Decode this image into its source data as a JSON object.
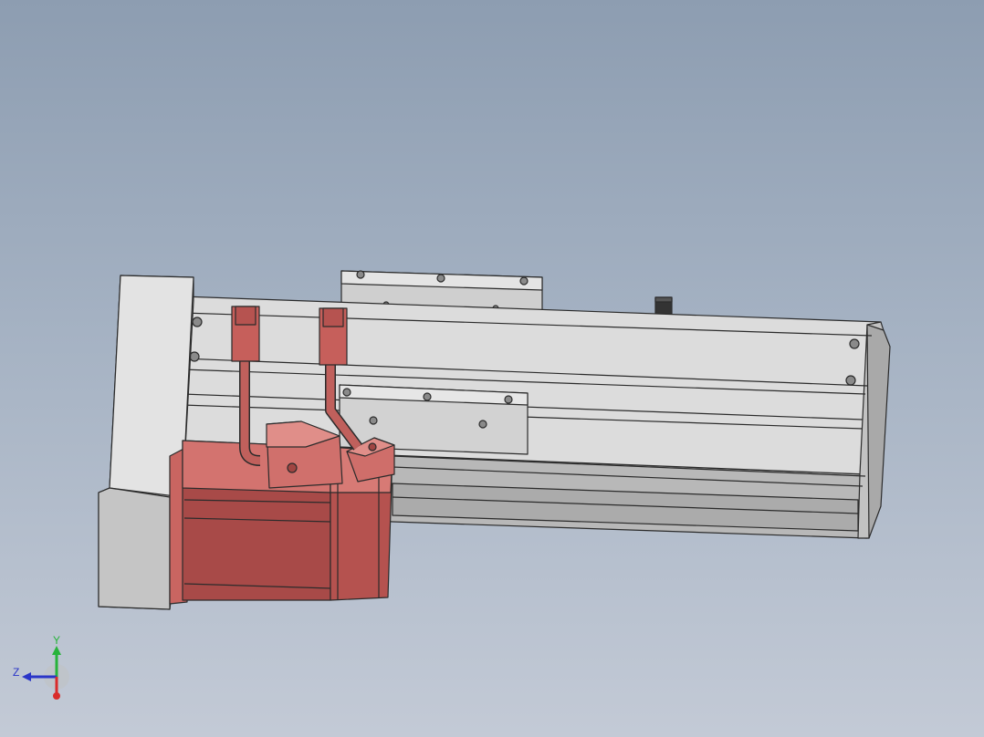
{
  "viewport": {
    "background_top": "#8d9db1",
    "background_bottom": "#c3cad6"
  },
  "model": {
    "body_color": "#d6d6d6",
    "motor_color": "#cd6f6b",
    "edge_color": "#2b2b2b"
  },
  "triad": {
    "y_label": "Y",
    "z_label": "Z",
    "x_color": "#d92b2b",
    "y_color": "#27b33b",
    "z_color": "#2a35c8"
  }
}
